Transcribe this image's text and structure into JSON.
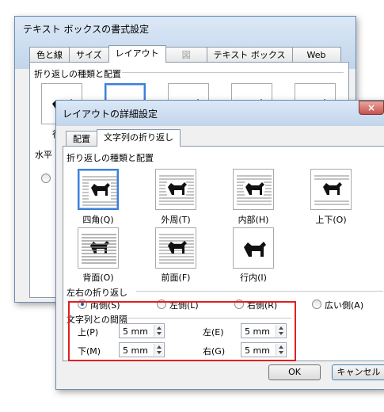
{
  "back_dialog": {
    "title": "テキスト ボックスの書式設定",
    "tabs": [
      "色と線",
      "サイズ",
      "レイアウト",
      "図",
      "テキスト ボックス",
      "Web"
    ],
    "selected_tab": "レイアウト",
    "section_label": "折り返しの種類と配置",
    "partial_label_1": "行",
    "partial_label_2": "水平"
  },
  "dialog": {
    "title": "レイアウトの詳細設定",
    "close_glyph": "×",
    "tabs": [
      "配置",
      "文字列の折り返し"
    ],
    "selected_tab": "文字列の折り返し",
    "wrap_section_label": "折り返しの種類と配置",
    "wrap_styles": [
      {
        "label": "四角(Q)",
        "icon": "square-wrap-icon",
        "selected": true
      },
      {
        "label": "外周(T)",
        "icon": "tight-wrap-icon",
        "selected": false
      },
      {
        "label": "内部(H)",
        "icon": "through-wrap-icon",
        "selected": false
      },
      {
        "label": "上下(O)",
        "icon": "top-bottom-wrap-icon",
        "selected": false
      },
      {
        "label": "背面(O)",
        "icon": "behind-text-icon",
        "selected": false
      },
      {
        "label": "前面(F)",
        "icon": "in-front-of-text-icon",
        "selected": false
      },
      {
        "label": "行内(I)",
        "icon": "inline-with-text-icon",
        "selected": false
      }
    ],
    "lr_section_label": "左右の折り返し",
    "lr_options": [
      {
        "label": "両側(S)",
        "selected": true
      },
      {
        "label": "左側(L)",
        "selected": false
      },
      {
        "label": "右側(R)",
        "selected": false
      },
      {
        "label": "広い側(A)",
        "selected": false
      }
    ],
    "distance_section_label": "文字列との間隔",
    "distances": {
      "top": {
        "label": "上(P)",
        "value": "5 mm"
      },
      "left": {
        "label": "左(E)",
        "value": "5 mm"
      },
      "bottom": {
        "label": "下(M)",
        "value": "5 mm"
      },
      "right": {
        "label": "右(G)",
        "value": "5 mm"
      }
    },
    "ok_label": "OK",
    "cancel_label": "キャンセル"
  },
  "colors": {
    "highlight_box": "#e02020",
    "selection_accent": "#3c7fd9"
  }
}
